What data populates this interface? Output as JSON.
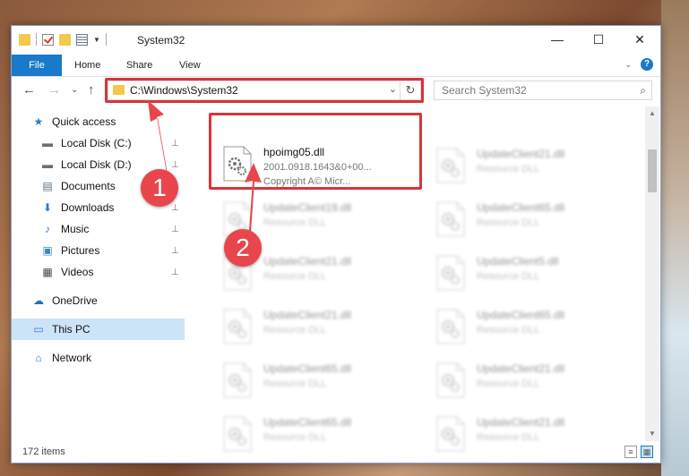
{
  "window": {
    "title": "System32",
    "controls": {
      "minimize": "—",
      "maximize": "☐",
      "close": "✕"
    }
  },
  "ribbon": {
    "tabs": [
      "File",
      "Home",
      "Share",
      "View"
    ],
    "collapse": "⌄",
    "help": "?"
  },
  "nav": {
    "back": "←",
    "forward": "→",
    "recent": "⌄",
    "up": "↑",
    "address": "C:\\Windows\\System32",
    "address_dropdown": "⌄",
    "refresh": "↻",
    "search_placeholder": "Search System32",
    "search_icon": "⌕"
  },
  "sidebar": {
    "items": [
      {
        "label": "Quick access",
        "icon": "star-icon",
        "glyph": "★",
        "color": "#2b7cd3",
        "pinned": false
      },
      {
        "label": "Local Disk (C:)",
        "icon": "drive-icon",
        "glyph": "▬",
        "color": "#6d6d6d",
        "pinned": true
      },
      {
        "label": "Local Disk (D:)",
        "icon": "drive-icon",
        "glyph": "▬",
        "color": "#6d6d6d",
        "pinned": true
      },
      {
        "label": "Documents",
        "icon": "document-icon",
        "glyph": "▤",
        "color": "#5b6f86",
        "pinned": true
      },
      {
        "label": "Downloads",
        "icon": "download-icon",
        "glyph": "⬇",
        "color": "#2b7cd3",
        "pinned": true
      },
      {
        "label": "Music",
        "icon": "music-icon",
        "glyph": "♪",
        "color": "#2b7cd3",
        "pinned": true
      },
      {
        "label": "Pictures",
        "icon": "pictures-icon",
        "glyph": "▣",
        "color": "#3a86c8",
        "pinned": true
      },
      {
        "label": "Videos",
        "icon": "video-icon",
        "glyph": "▦",
        "color": "#444444",
        "pinned": true
      },
      {
        "label": "OneDrive",
        "icon": "cloud-icon",
        "glyph": "☁",
        "color": "#1f6fbf",
        "pinned": false
      },
      {
        "label": "This PC",
        "icon": "computer-icon",
        "glyph": "▭",
        "color": "#2b7cd3",
        "pinned": false
      },
      {
        "label": "Network",
        "icon": "network-icon",
        "glyph": "⌂",
        "color": "#2b7cd3",
        "pinned": false
      }
    ],
    "pin_glyph": "📌"
  },
  "files": {
    "highlighted": {
      "name": "hpoimg05.dll",
      "line2": "2001.0918.1643&0+00...",
      "line3": "Copyright A© Micr..."
    },
    "left_column": [
      {
        "name": "UpdateClient19.dll",
        "desc": "Resource DLL"
      },
      {
        "name": "UpdateClient21.dll",
        "desc": "Resource DLL"
      },
      {
        "name": "UpdateClient21.dll",
        "desc": "Resource DLL"
      },
      {
        "name": "UpdateClient65.dll",
        "desc": "Resource DLL"
      },
      {
        "name": "UpdateClient65.dll",
        "desc": "Resource DLL"
      }
    ],
    "right_column": [
      {
        "name": "UpdateClient21.dll",
        "desc": "Resource DLL"
      },
      {
        "name": "UpdateClient65.dll",
        "desc": "Resource DLL"
      },
      {
        "name": "UpdateClient5.dll",
        "desc": "Resource DLL"
      },
      {
        "name": "UpdateClient65.dll",
        "desc": "Resource DLL"
      },
      {
        "name": "UpdateClient21.dll",
        "desc": "Resource DLL"
      },
      {
        "name": "UpdateClient21.dll",
        "desc": "Resource DLL"
      }
    ]
  },
  "status": {
    "item_count": "172 items"
  },
  "annotations": {
    "badge1": "1",
    "badge2": "2",
    "color": "#e8464c"
  }
}
